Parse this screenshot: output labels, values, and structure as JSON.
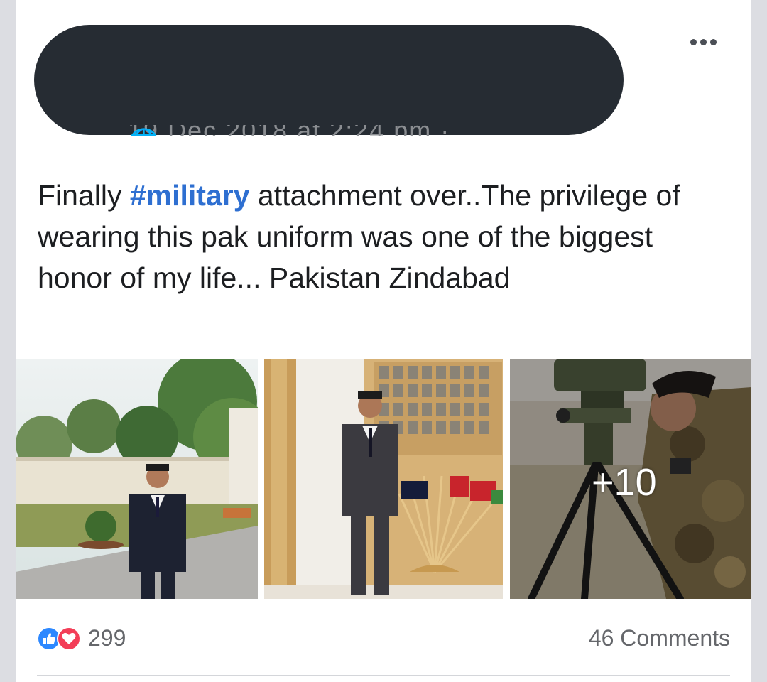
{
  "post": {
    "header_meta": "19 Dec 2018 at 2:24 pm · 🌐",
    "text_before": "Finally ",
    "hashtag": "#military",
    "text_after": " attachment over..The privilege of wearing this pak uniform was one of the biggest honor of my life... Pakistan Zindabad",
    "photos": [
      {
        "icon": "garden-photo"
      },
      {
        "icon": "portrait-indoor-photo"
      },
      {
        "icon": "soldier-rangefinder-photo"
      }
    ],
    "more_photos_label": "+10"
  },
  "reactions": {
    "count": "299",
    "colors": {
      "like": "#2d88ff",
      "love": "#f33e58"
    }
  },
  "comments_label": "46 Comments",
  "colors": {
    "hashtag": "#2e6fd1",
    "redaction": "#262c33"
  }
}
